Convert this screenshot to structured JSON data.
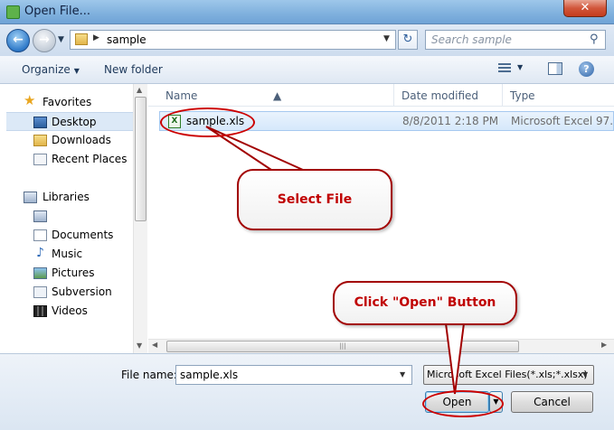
{
  "window": {
    "title": "Open File...",
    "close_glyph": "✕"
  },
  "address": {
    "path": "sample",
    "search_placeholder": "Search sample"
  },
  "toolbar": {
    "organize_label": "Organize",
    "new_folder_label": "New folder"
  },
  "nav": {
    "favorites_label": "Favorites",
    "items": [
      {
        "label": "Desktop",
        "icon": "desktop-icon"
      },
      {
        "label": "Downloads",
        "icon": "downloads-folder-icon"
      },
      {
        "label": "Recent Places",
        "icon": "recent-places-icon"
      }
    ],
    "libraries_label": "Libraries",
    "library_items": [
      {
        "label": "Documents",
        "icon": "documents-icon"
      },
      {
        "label": "Music",
        "icon": "music-icon"
      },
      {
        "label": "Pictures",
        "icon": "pictures-icon"
      },
      {
        "label": "Subversion",
        "icon": "subversion-icon"
      },
      {
        "label": "Videos",
        "icon": "videos-icon"
      }
    ],
    "selected": "Desktop"
  },
  "columns": {
    "name": "Name",
    "date": "Date modified",
    "type": "Type"
  },
  "files": [
    {
      "name": "sample.xls",
      "date": "8/8/2011 2:18 PM",
      "type": "Microsoft Excel 97..."
    }
  ],
  "bottom": {
    "file_name_label": "File name:",
    "file_name_value": "sample.xls",
    "file_type_value": "Microsoft Excel Files(*.xls;*.xlsx)",
    "open_label": "Open",
    "cancel_label": "Cancel"
  },
  "annotations": {
    "select_file": "Select File",
    "click_open": "Click \"Open\" Button"
  },
  "colors": {
    "annotation_red": "#cc0000",
    "selection_blue": "#d6e8fb",
    "titlebar_blue": "#7fb0dd"
  }
}
